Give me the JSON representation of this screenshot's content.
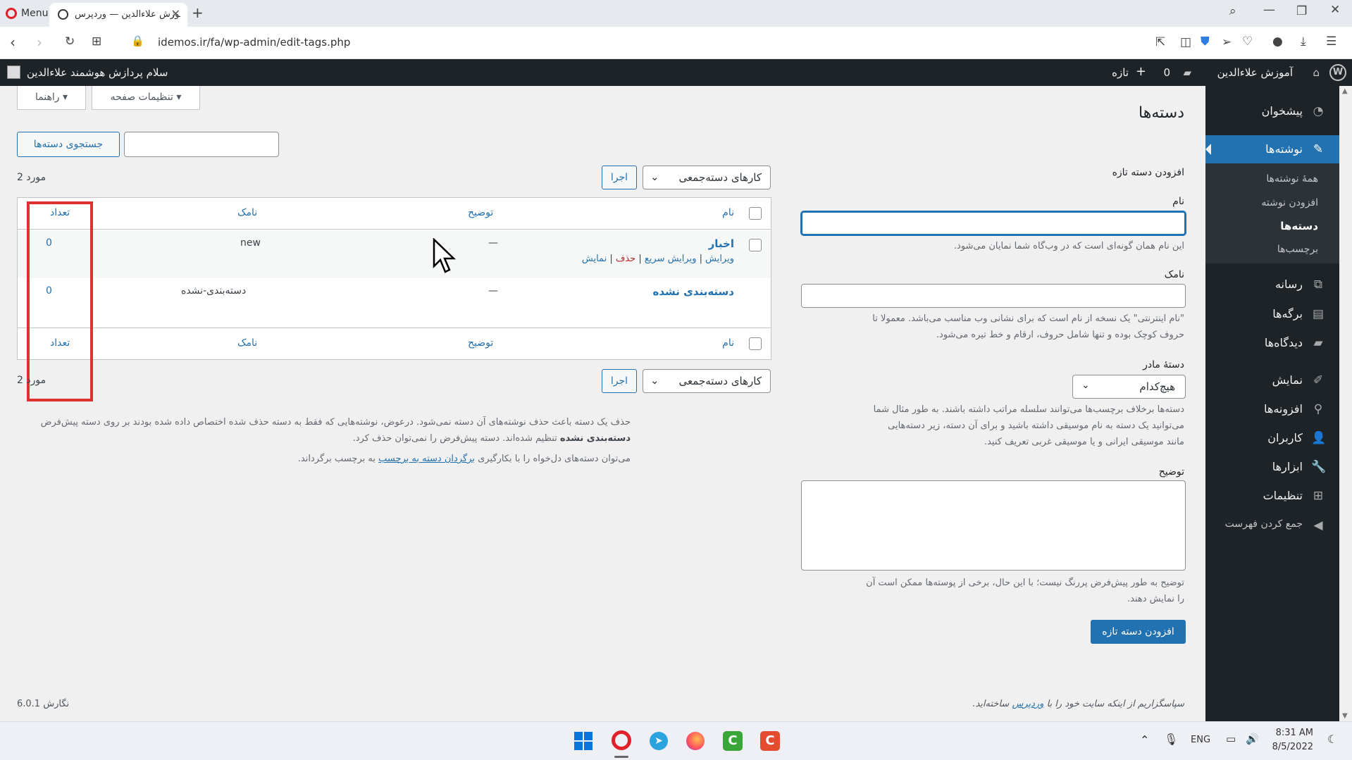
{
  "browser": {
    "menu_label": "Menu",
    "tab_title": "آموزش علاءالدین — وردپرس",
    "url": "idemos.ir/fa/wp-admin/edit-tags.php"
  },
  "adminbar": {
    "site_name": "آموزش علاءالدین",
    "comments_count": "0",
    "new_label": "تازه",
    "greeting": "سلام پردازش هوشمند علاءالدین"
  },
  "sidebar": {
    "dashboard": "پیشخوان",
    "posts": "نوشته‌ها",
    "all_posts": "همهٔ نوشته‌ها",
    "add_post": "افزودن نوشته",
    "categories": "دسته‌ها",
    "tags": "برچسب‌ها",
    "media": "رسانه",
    "pages": "برگه‌ها",
    "comments": "دیدگاه‌ها",
    "appearance": "نمایش",
    "plugins": "افزونه‌ها",
    "users": "کاربران",
    "tools": "ابزارها",
    "settings": "تنظیمات",
    "collapse": "جمع کردن فهرست"
  },
  "header": {
    "page_title": "دسته‌ها",
    "screen_options": "تنظیمات صفحه",
    "help": "راهنما"
  },
  "search": {
    "button": "جستجوی دسته‌ها"
  },
  "form": {
    "title": "افزودن دسته تازه",
    "name_label": "نام",
    "name_help": "این نام همان گونه‌ای است که در وب‌گاه شما نمایان می‌شود.",
    "slug_label": "نامک",
    "slug_help_1": "\"نام اینترنتی\" یک نسخه از نام است که برای نشانی وب مناسب می‌باشد. معمولا تا",
    "slug_help_2": "حروف کوچک بوده و تنها شامل حروف، ارقام و خط تیره می‌شود.",
    "parent_label": "دستهٔ مادر",
    "parent_value": "هیچ‌کدام",
    "parent_help_1": "دسته‌ها برخلاف برچسب‌ها می‌توانند سلسله مراتب داشته باشند. به طور مثال شما",
    "parent_help_2": "می‌توانید یک دسته به نام موسیقی داشته باشید و برای آن دسته، زیر دسته‌هایی",
    "parent_help_3": "مانند موسیقی ایرانی و یا موسیقی غربی تعریف کنید.",
    "desc_label": "توضیح",
    "desc_help_1": "توضیح به طور پیش‌فرض پررنگ نیست؛ با این حال، برخی از پوسته‌ها ممکن است آن",
    "desc_help_2": "را نمایش دهند.",
    "submit": "افزودن دسته تازه"
  },
  "table": {
    "bulk_label": "کارهای دسته‌جمعی",
    "apply": "اجرا",
    "count_text": "2 مورد",
    "col_name": "نام",
    "col_desc": "توضیح",
    "col_slug": "نامک",
    "col_count": "تعداد",
    "rows": [
      {
        "name": "اخبار",
        "desc": "—",
        "slug": "new",
        "count": "0",
        "actions": {
          "edit": "ویرایش",
          "quick": "ویرایش سریع",
          "delete": "حذف",
          "view": "نمایش"
        }
      },
      {
        "name": "دسته‌بندی نشده",
        "desc": "—",
        "slug": "دسته‌بندی-نشده",
        "count": "0"
      }
    ]
  },
  "notes": {
    "line1": "حذف یک دسته باعث حذف نوشته‌های آن دسته نمی‌شود. درعوض، نوشته‌هایی که فقط به دسته حذف شده اختصاص داده شده بودند بر روی دسته پیش‌فرض",
    "line2_bold": "دسته‌بندی نشده",
    "line2_rest": " تنظیم شده‌اند. دسته پیش‌فرض را نمی‌توان حذف کرد.",
    "line3_pre": "می‌توان دسته‌های دل‌خواه را با بکارگیری ",
    "line3_link": "برگردان دسته به برچسب",
    "line3_post": " به برچسب برگرداند."
  },
  "footer": {
    "thanks_pre": "سپاسگزاریم از اینکه سایت خود را با ",
    "thanks_link": "وردپرس",
    "thanks_post": " ساخته‌اید.",
    "version": "نگارش 6.0.1"
  },
  "taskbar": {
    "lang": "ENG",
    "time": "8:31 AM",
    "date": "8/5/2022"
  },
  "colors": {
    "accent": "#2271b1",
    "highlight": "#dc3232",
    "admin_dark": "#1d2327"
  }
}
